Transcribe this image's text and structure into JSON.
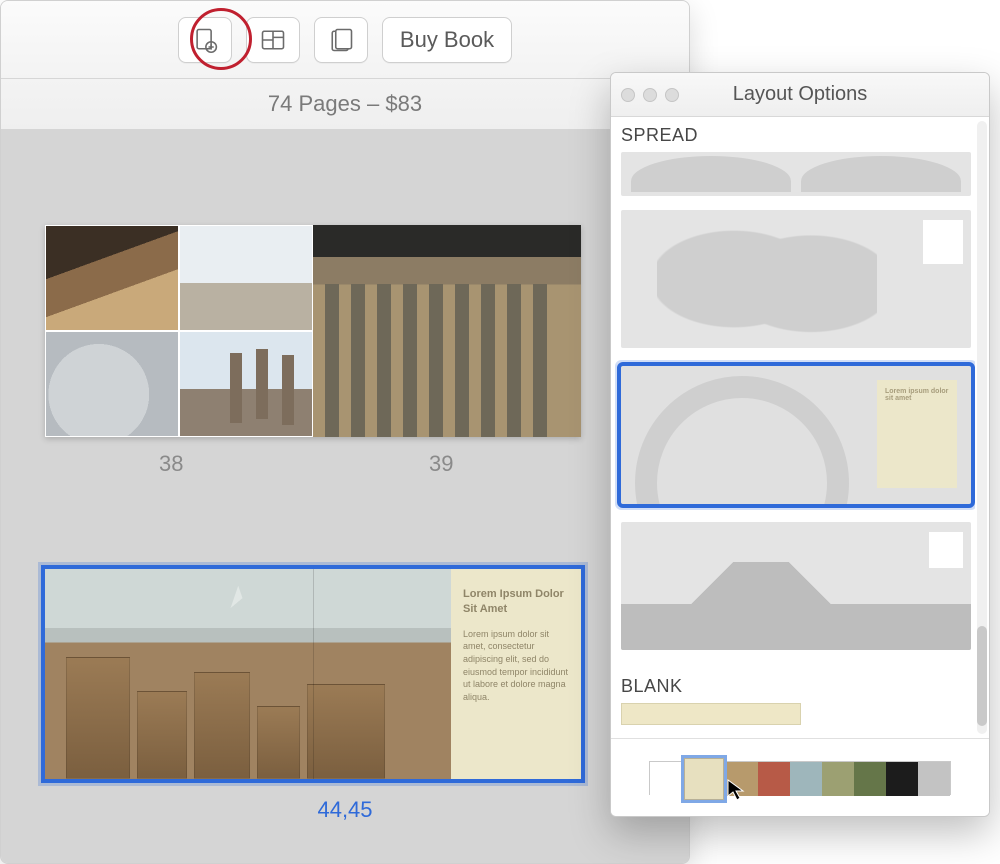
{
  "toolbar": {
    "add_label": "",
    "layout_label": "",
    "themes_label": "",
    "buy_label": "Buy Book"
  },
  "subhead": "74 Pages – $83",
  "spread1": {
    "left_page_num": "38",
    "right_page_num": "39"
  },
  "spread2": {
    "label": "44,45",
    "text_title": "Lorem Ipsum Dolor Sit Amet",
    "text_body": "Lorem ipsum dolor sit amet, consectetur adipiscing elit, sed do eiusmod tempor incididunt ut labore et dolore magna aliqua."
  },
  "panel": {
    "title": "Layout Options",
    "sections": {
      "spread": "SPREAD",
      "blank": "BLANK"
    },
    "swatch_colors": [
      "#ffffff",
      "#e7e0bf",
      "#b79a6c",
      "#b75a47",
      "#9eb6bb",
      "#9ca072",
      "#657649",
      "#1c1c1c",
      "#c3c3c3"
    ],
    "selected_swatch": 1,
    "eiffel_text": "Lorem ipsum dolor sit amet"
  }
}
